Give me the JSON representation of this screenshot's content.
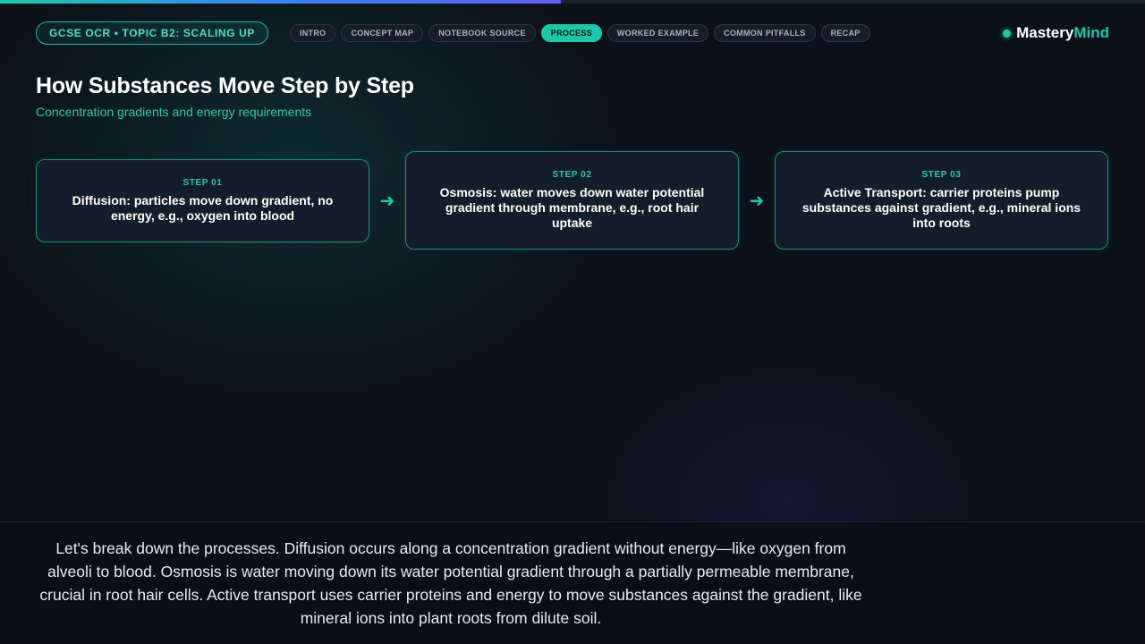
{
  "header": {
    "topic": "GCSE OCR • TOPIC B2: SCALING UP",
    "tabs": [
      {
        "label": "INTRO",
        "active": false
      },
      {
        "label": "CONCEPT MAP",
        "active": false
      },
      {
        "label": "NOTEBOOK SOURCE",
        "active": false
      },
      {
        "label": "PROCESS",
        "active": true
      },
      {
        "label": "WORKED EXAMPLE",
        "active": false
      },
      {
        "label": "COMMON PITFALLS",
        "active": false
      },
      {
        "label": "RECAP",
        "active": false
      }
    ],
    "brand_part1": "Mastery",
    "brand_part2": "Mind"
  },
  "progress": {
    "value": 0.49
  },
  "slide": {
    "title": "How Substances Move Step by Step",
    "subtitle": "Concentration gradients and energy requirements",
    "steps": [
      {
        "label": "STEP 01",
        "text": "Diffusion: particles move down gradient, no energy, e.g., oxygen into blood"
      },
      {
        "label": "STEP 02",
        "text": "Osmosis: water moves down water potential gradient through membrane, e.g., root hair uptake"
      },
      {
        "label": "STEP 03",
        "text": "Active Transport: carrier proteins pump substances against gradient, e.g., mineral ions into roots"
      }
    ]
  },
  "narration": {
    "text": "Let's break down the processes. Diffusion occurs along a concentration gradient without energy—like oxygen from alveoli to blood. Osmosis is water moving down its water potential gradient through a partially permeable membrane, crucial in root hair cells. Active transport uses carrier proteins and energy to move substances against the gradient, like mineral ions into plant roots from dilute soil."
  },
  "colors": {
    "accent": "#1ec7a8",
    "background": "#0b111a",
    "card": "#141d2b"
  },
  "icons": {
    "step_arrow": "arrow-right-icon",
    "brand_dot": "status-dot-icon"
  }
}
